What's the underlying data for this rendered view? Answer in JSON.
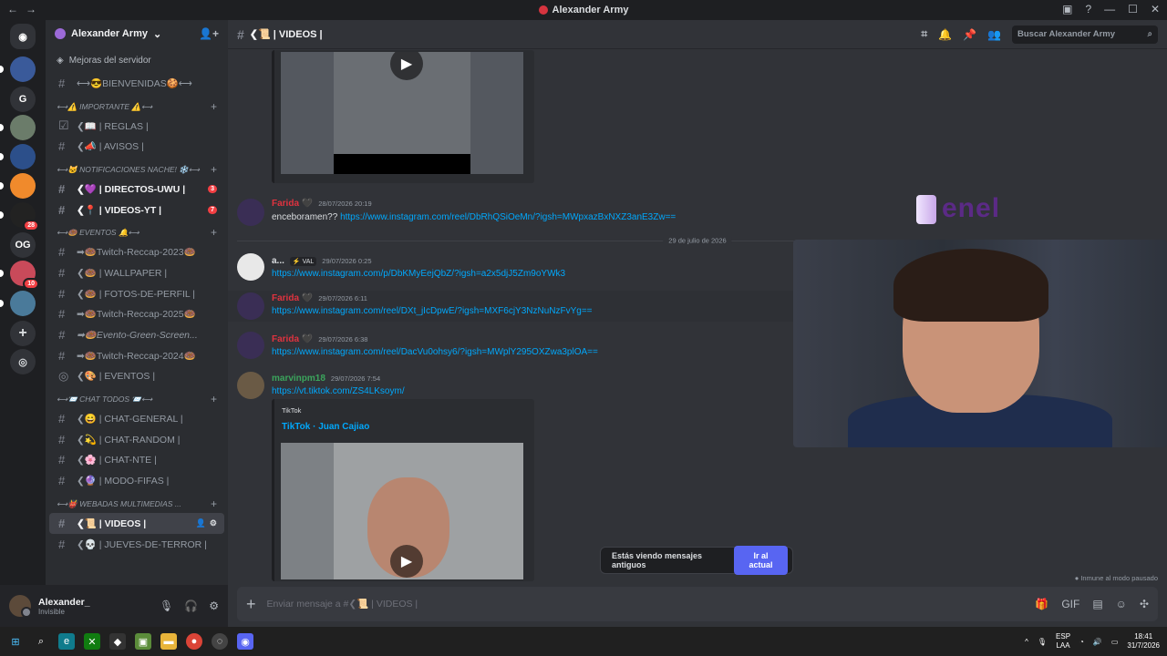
{
  "window": {
    "title": "Alexander Army"
  },
  "servers": [
    {
      "label": "",
      "color": "#3a5a9a"
    },
    {
      "label": "G",
      "color": "#313338"
    },
    {
      "label": "",
      "color": "#6b7c6a"
    },
    {
      "label": "",
      "color": "#2c4f8a"
    },
    {
      "label": "",
      "color": "#f08a2c"
    },
    {
      "label": "28",
      "color": "#222222"
    },
    {
      "label": "OG",
      "color": "#313338"
    },
    {
      "label": "10",
      "color": "#c94a5a"
    },
    {
      "label": "",
      "color": "#4a7a9a"
    }
  ],
  "server_badges": {
    "s6": "28",
    "s8": "10"
  },
  "guild": {
    "name": "Alexander Army",
    "boost_label": "Mejoras del servidor"
  },
  "sidebar": {
    "ch_bienvenidas": "⟷😎BIENVENIDAS🍪⟷",
    "cat_importante": "⟷⚠️ IMPORTANTE ⚠️⟷",
    "ch_reglas": "❮📖 | REGLAS |",
    "ch_avisos": "❮📣 | AVISOS |",
    "cat_notificaciones": "⟷🐱 NOTIFICACIONES NACHE! ❄️⟷",
    "ch_directos": "❮💜 | DIRECTOS-UWU |",
    "ch_directos_count": "3",
    "ch_videos_yt": "❮📍 | VIDEOS-YT |",
    "ch_videos_yt_count": "7",
    "cat_eventos": "⟷🍩 EVENTOS 🔔⟷",
    "ch_reccap23": "➡🍩Twitch-Reccap-2023🍩",
    "ch_wallpaper": "❮🍩 | WALLPAPER |",
    "ch_fotos": "❮🍩 | FOTOS-DE-PERFIL |",
    "ch_reccap25": "➡🍩Twitch-Reccap-2025🍩",
    "ch_green": "➡🍩Evento-Green-Screen...",
    "ch_reccap24": "➡🍩Twitch-Reccap-2024🍩",
    "ch_eventos": "❮🎨 | EVENTOS |",
    "cat_chat": "⟷📨 CHAT TODOS 📨⟷",
    "ch_general": "❮😄 | CHAT-GENERAL |",
    "ch_random": "❮💫 | CHAT-RANDOM |",
    "ch_nte": "❮🌸 | CHAT-NTE |",
    "ch_fifas": "❮🔮 | MODO-FIFAS |",
    "cat_webadas": "⟷👹 WEBADAS MULTIMEDIAS ...",
    "ch_videos": "❮📜 | VIDEOS |",
    "ch_jueves": "❮💀 | JUEVES-DE-TERROR |"
  },
  "user": {
    "name": "Alexander_",
    "status": "Invisible"
  },
  "header": {
    "channel": "❮📜 | VIDEOS |",
    "search_placeholder": "Buscar Alexander Army"
  },
  "messages": {
    "m1": {
      "author": "Farida 🖤",
      "author_color": "#e0333f",
      "time": "28/07/2026 20:19",
      "text": "enceboramen?? ",
      "link": "https://www.instagram.com/reel/DbRhQSiOeMn/?igsh=MWpxazBxNXZ3anE3Zw=="
    },
    "date_divider": "29 de julio de 2026",
    "m2": {
      "author": "a...",
      "tag": "⚡ VAL",
      "time": "29/07/2026 0:25",
      "link": "https://www.instagram.com/p/DbKMyEejQbZ/?igsh=a2x5djJ5Zm9oYWk3"
    },
    "m3": {
      "author": "Farida 🖤",
      "time": "29/07/2026 6:11",
      "link": "https://www.instagram.com/reel/DXt_jIcDpwE/?igsh=MXF6cjY3NzNuNzFvYg=="
    },
    "m4": {
      "author": "Farida 🖤",
      "time": "29/07/2026 6:38",
      "link": "https://www.instagram.com/reel/DacVu0ohsy6/?igsh=MWplY295OXZwa3plOA=="
    },
    "m5": {
      "author": "marvinpm18",
      "author_color": "#3ba55c",
      "time": "29/07/2026 7:54",
      "link": "https://vt.tiktok.com/ZS4LKsoym/",
      "embed_provider": "TikTok",
      "embed_title": "TikTok · Juan Cajiao"
    }
  },
  "overlay": {
    "brand": "enel"
  },
  "notice": {
    "text": "Estás viendo mensajes antiguos",
    "button": "Ir al actual"
  },
  "idle_text": "Inmune al modo pausado",
  "composer": {
    "placeholder": "Enviar mensaje a #❮📜 | VIDEOS |"
  },
  "taskbar": {
    "lang_top": "ESP",
    "lang_bottom": "LAA",
    "time": "18:41",
    "date": "31/7/2026"
  }
}
